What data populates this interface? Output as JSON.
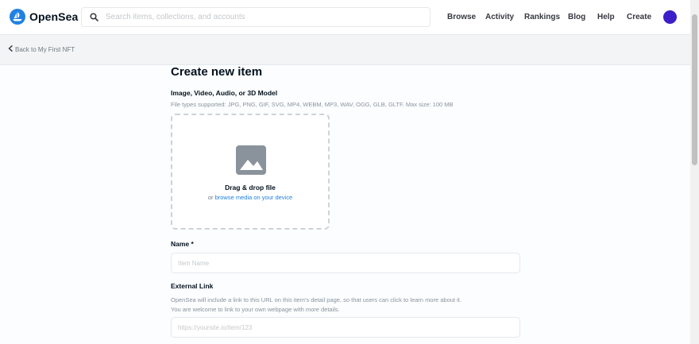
{
  "header": {
    "brand": "OpenSea",
    "search_placeholder": "Search items, collections, and accounts",
    "nav": [
      "Browse",
      "Activity",
      "Rankings",
      "Blog",
      "Help",
      "Create"
    ]
  },
  "subheader": {
    "back_label": "Back to My First NFT"
  },
  "form": {
    "title": "Create new item",
    "media_label": "Image, Video, Audio, or 3D Model",
    "media_hint": "File types supported: JPG, PNG, GIF, SVG, MP4, WEBM, MP3, WAV, OGG, GLB, GLTF. Max size: 100 MB",
    "drag_title": "Drag & drop file",
    "drag_or": "or",
    "drag_browse": "browse media on your device",
    "name_label": "Name *",
    "name_placeholder": "Item Name",
    "link_label": "External Link",
    "link_hint_1": "OpenSea will include a link to this URL on this item's detail page, so that users can click to learn more about it.",
    "link_hint_2": "You are welcome to link to your own webpage with more details.",
    "link_placeholder": "https://yoursite.io/item/123"
  },
  "colors": {
    "brand_blue": "#2081e2",
    "avatar": "#3d1fc9"
  },
  "icons": [
    "opensea-logo-icon",
    "search-icon",
    "chevron-left-icon",
    "image-placeholder-icon"
  ]
}
